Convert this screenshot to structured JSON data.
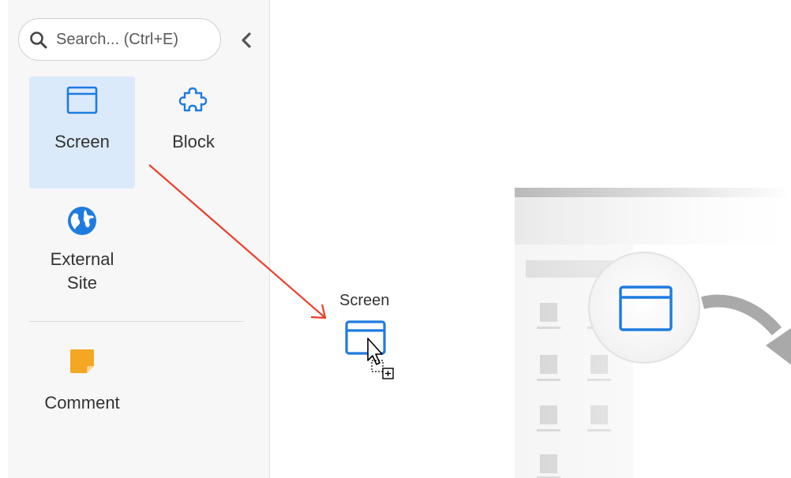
{
  "search": {
    "placeholder": "Search... (Ctrl+E)"
  },
  "sidebar": {
    "items": [
      {
        "label": "Screen"
      },
      {
        "label": "Block"
      },
      {
        "label_line1": "External",
        "label_line2": "Site"
      },
      {
        "label": "Comment"
      }
    ]
  },
  "drag": {
    "label": "Screen"
  },
  "colors": {
    "accent": "#1e7be0",
    "selected_bg": "#dbeafb",
    "arrow": "#e8402a",
    "comment_note": "#f5a623"
  }
}
